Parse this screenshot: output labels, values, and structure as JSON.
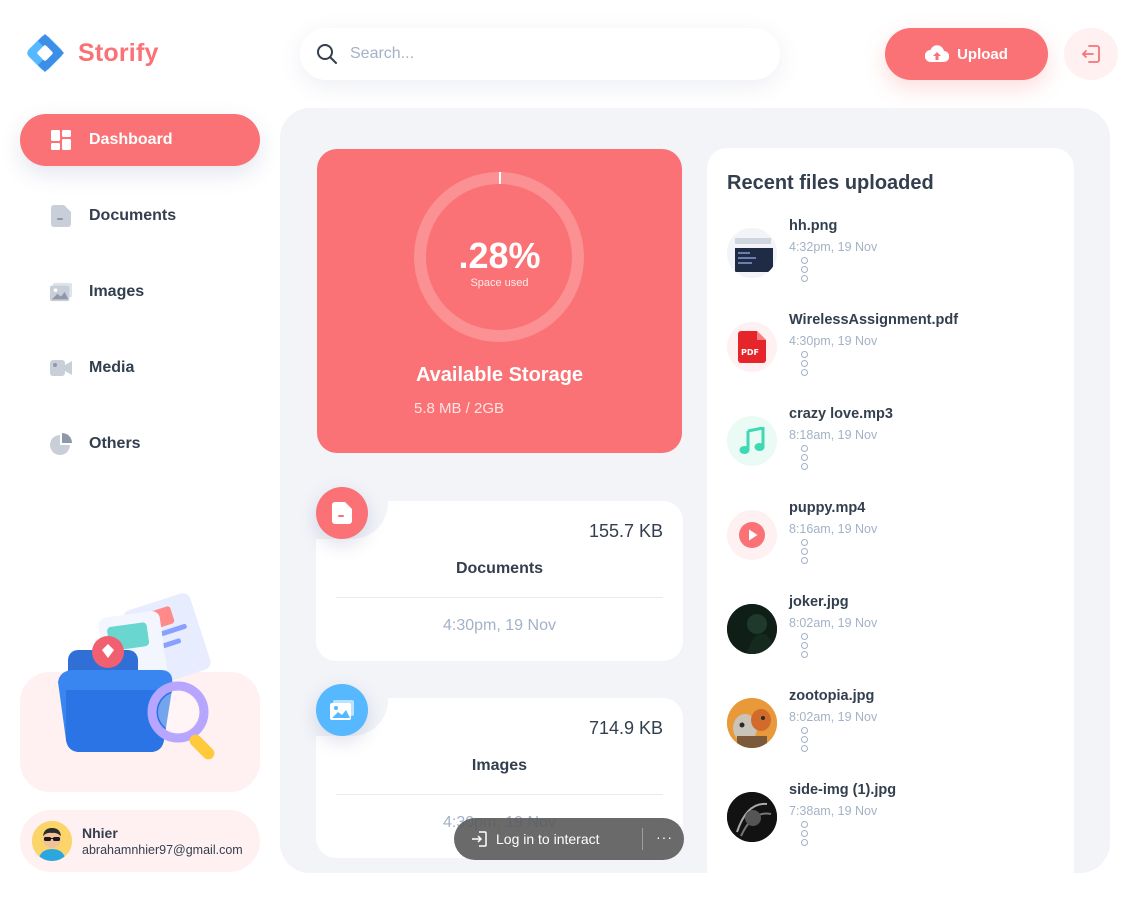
{
  "app": {
    "name": "Storify"
  },
  "search": {
    "placeholder": "Search..."
  },
  "header": {
    "upload_label": "Upload"
  },
  "colors": {
    "brand": "#fa7275",
    "text": "#333f4e",
    "muted": "#a3b2c7",
    "panel": "#f2f4f8",
    "blue": "#56b8ff"
  },
  "sidebar": {
    "items": [
      {
        "label": "Dashboard",
        "icon": "dashboard-icon",
        "active": true
      },
      {
        "label": "Documents",
        "icon": "document-icon",
        "active": false
      },
      {
        "label": "Images",
        "icon": "image-icon",
        "active": false
      },
      {
        "label": "Media",
        "icon": "video-icon",
        "active": false
      },
      {
        "label": "Others",
        "icon": "pie-chart-icon",
        "active": false
      }
    ]
  },
  "user": {
    "name": "Nhier",
    "email": "abrahamnhier97@gmail.com"
  },
  "storage": {
    "percent_label": ".28%",
    "percent_value": 0.28,
    "sub_label": "Space used",
    "title": "Available Storage",
    "usage": "5.8 MB / 2GB"
  },
  "categories": [
    {
      "label": "Documents",
      "size": "155.7 KB",
      "date": "4:30pm, 19 Nov",
      "icon": "document-icon"
    },
    {
      "label": "Images",
      "size": "714.9 KB",
      "date": "4:30pm, 19 Nov",
      "icon": "image-icon"
    }
  ],
  "recent": {
    "title": "Recent files uploaded",
    "files": [
      {
        "name": "hh.png",
        "time": "4:32pm, 19 Nov",
        "icon": "image-thumbnail"
      },
      {
        "name": "WirelessAssignment.pdf",
        "time": "4:30pm, 19 Nov",
        "icon": "pdf-icon"
      },
      {
        "name": "crazy love.mp3",
        "time": "8:18am, 19 Nov",
        "icon": "music-note-icon"
      },
      {
        "name": "puppy.mp4",
        "time": "8:16am, 19 Nov",
        "icon": "play-icon"
      },
      {
        "name": "joker.jpg",
        "time": "8:02am, 19 Nov",
        "icon": "image-thumbnail"
      },
      {
        "name": "zootopia.jpg",
        "time": "8:02am, 19 Nov",
        "icon": "image-thumbnail"
      },
      {
        "name": "side-img (1).jpg",
        "time": "7:38am, 19 Nov",
        "icon": "image-thumbnail"
      }
    ]
  },
  "toast": {
    "label": "Log in to interact",
    "more": "···"
  }
}
